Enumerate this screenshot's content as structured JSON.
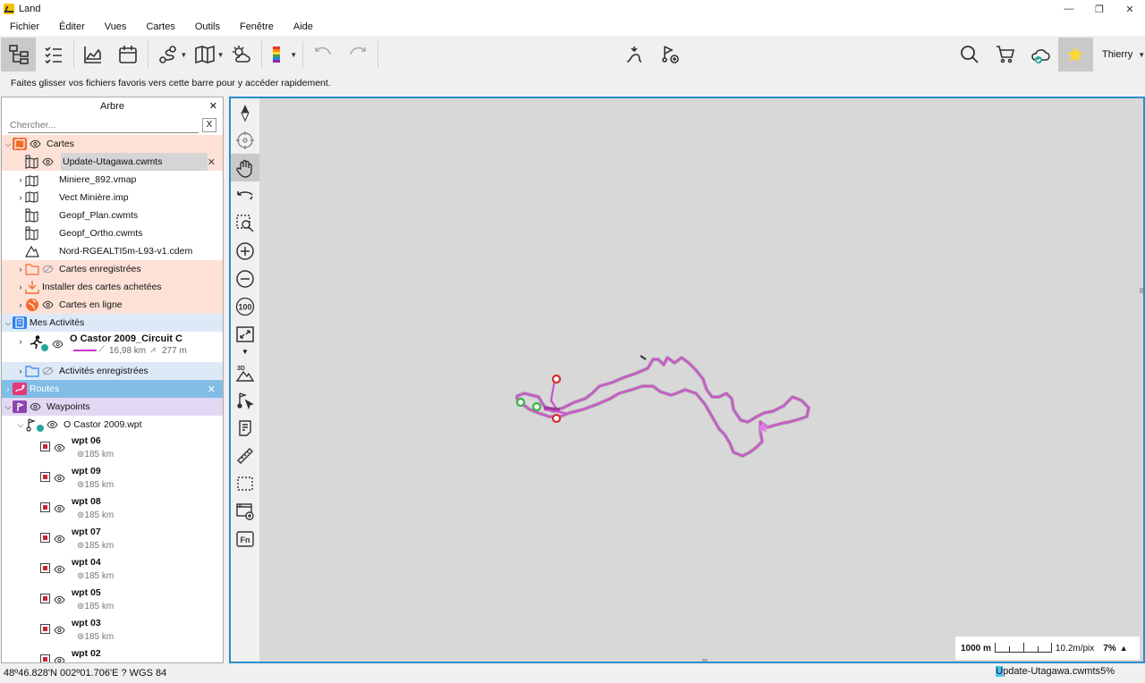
{
  "window": {
    "title": "Land",
    "controls": {
      "minimize": "—",
      "maximize": "❐",
      "close": "✕"
    }
  },
  "menu": [
    "Fichier",
    "Éditer",
    "Vues",
    "Cartes",
    "Outils",
    "Fenêtre",
    "Aide"
  ],
  "toolbar": {
    "user": "Thierry"
  },
  "favbar": {
    "hint": "Faites glisser vos fichiers favoris vers cette barre pour y accéder rapidement."
  },
  "tree": {
    "title": "Arbre",
    "close": "✕",
    "search_placeholder": "Chercher...",
    "search_clear": "X",
    "cartes": {
      "label": "Cartes",
      "items": [
        {
          "label": "Update-Utagawa.cwmts",
          "selected": true
        },
        {
          "label": "Miniere_892.vmap"
        },
        {
          "label": "Vect Minière.imp"
        },
        {
          "label": "Geopf_Plan.cwmts"
        },
        {
          "label": "Geopf_Ortho.cwmts"
        },
        {
          "label": "Nord-RGEALTI5m-L93-v1.cdem"
        }
      ],
      "saved": "Cartes enregistrées",
      "install": "Installer des cartes achetées",
      "online": "Cartes en ligne"
    },
    "activities": {
      "label": "Mes Activités",
      "item": {
        "name": "O Castor 2009_Circuit C",
        "distance": "16,98 km",
        "elevation": "277 m"
      },
      "saved": "Activités enregistrées"
    },
    "routes": {
      "label": "Routes",
      "close": "✕"
    },
    "waypoints": {
      "label": "Waypoints",
      "file": "O Castor 2009.wpt",
      "items": [
        {
          "name": "wpt 06",
          "dist": "185 km"
        },
        {
          "name": "wpt 09",
          "dist": "185 km"
        },
        {
          "name": "wpt 08",
          "dist": "185 km"
        },
        {
          "name": "wpt 07",
          "dist": "185 km"
        },
        {
          "name": "wpt 04",
          "dist": "185 km"
        },
        {
          "name": "wpt 05",
          "dist": "185 km"
        },
        {
          "name": "wpt 03",
          "dist": "185 km"
        },
        {
          "name": "wpt 02",
          "dist": ""
        }
      ]
    }
  },
  "map": {
    "scale_left": "1000 m",
    "scale_right": "10.2m/pix",
    "zoom_pct": "7%",
    "scale_up": "▲",
    "track_color": "#cc55cc"
  },
  "status": {
    "coords": "48º46.828'N 002º01.706'E  ?  WGS 84",
    "map_name_hl": "U",
    "map_name_rest": "pdate-Utagawa.cwmts",
    "map_pct": "5%"
  }
}
